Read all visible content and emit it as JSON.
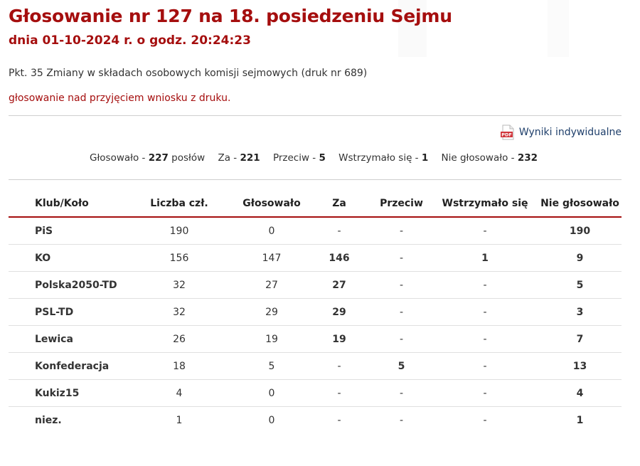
{
  "header": {
    "title": "Głosowanie nr 127 na 18. posiedzeniu Sejmu",
    "subtitle": "dnia 01-10-2024 r. o godz. 20:24:23"
  },
  "topic": "Pkt. 35 Zmiany w składach osobowych komisji sejmowych (druk nr 689)",
  "motion": "głosowanie nad przyjęciem wniosku z druku.",
  "pdf_link": {
    "label": "Wyniki indywidualne",
    "icon": "pdf-icon",
    "icon_text": "PDF"
  },
  "summary": {
    "voted_label": "Głosowało - ",
    "voted_value": "227",
    "voted_unit": " posłów",
    "for_label": "Za - ",
    "for_value": "221",
    "against_label": "Przeciw - ",
    "against_value": "5",
    "abstain_label": "Wstrzymało się - ",
    "abstain_value": "1",
    "absent_label": "Nie głosowało - ",
    "absent_value": "232"
  },
  "table": {
    "headers": [
      "Klub/Koło",
      "Liczba czł.",
      "Głosowało",
      "Za",
      "Przeciw",
      "Wstrzymało się",
      "Nie głosowało"
    ],
    "rows": [
      [
        "PiS",
        "190",
        "0",
        "-",
        "-",
        "-",
        "190"
      ],
      [
        "KO",
        "156",
        "147",
        "146",
        "-",
        "1",
        "9"
      ],
      [
        "Polska2050-TD",
        "32",
        "27",
        "27",
        "-",
        "-",
        "5"
      ],
      [
        "PSL-TD",
        "32",
        "29",
        "29",
        "-",
        "-",
        "3"
      ],
      [
        "Lewica",
        "26",
        "19",
        "19",
        "-",
        "-",
        "7"
      ],
      [
        "Konfederacja",
        "18",
        "5",
        "-",
        "5",
        "-",
        "13"
      ],
      [
        "Kukiz15",
        "4",
        "0",
        "-",
        "-",
        "-",
        "4"
      ],
      [
        "niez.",
        "1",
        "0",
        "-",
        "-",
        "-",
        "1"
      ]
    ]
  },
  "colors": {
    "heading_red": "#a50e0e",
    "link_blue": "#1f3f6b",
    "pdf_red": "#d0343a"
  }
}
